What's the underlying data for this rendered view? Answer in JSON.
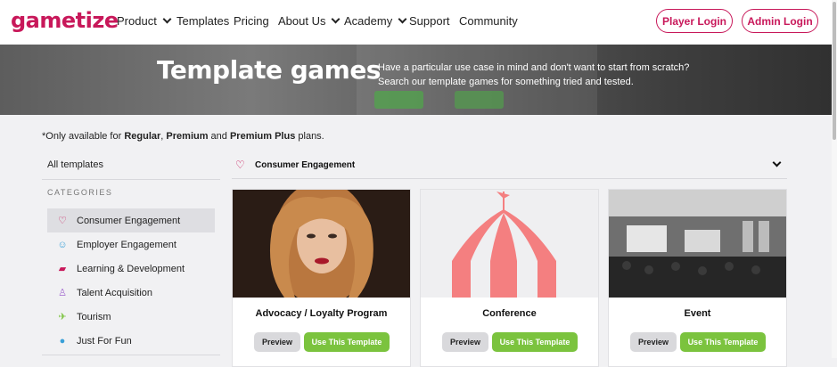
{
  "brand": {
    "logo_text": "gametize",
    "color": "#c8185a"
  },
  "nav": {
    "items": [
      {
        "label": "Product",
        "has_dropdown": true
      },
      {
        "label": "Templates",
        "has_dropdown": false
      },
      {
        "label": "Pricing",
        "has_dropdown": false
      },
      {
        "label": "About Us",
        "has_dropdown": true
      },
      {
        "label": "Academy",
        "has_dropdown": true
      },
      {
        "label": "Support",
        "has_dropdown": false
      },
      {
        "label": "Community",
        "has_dropdown": false
      }
    ],
    "player_login": "Player Login",
    "admin_login": "Admin Login"
  },
  "hero": {
    "title": "Template games",
    "subtitle_line1": "Have a particular use case in mind and don't want to start from scratch?",
    "subtitle_line2": "Search our template games for something tried and tested."
  },
  "note": {
    "prefix": "*Only available for ",
    "plan1": "Regular",
    "sep1": ", ",
    "plan2": "Premium",
    "sep2": " and ",
    "plan3": "Premium Plus",
    "suffix": " plans."
  },
  "sidebar": {
    "all_templates": "All templates",
    "categories_heading": "CATEGORIES",
    "categories": [
      {
        "label": "Consumer Engagement",
        "icon": "heart-icon",
        "color": "#c8185a",
        "active": true
      },
      {
        "label": "Employer Engagement",
        "icon": "smiley-icon",
        "color": "#3aa0d8",
        "active": false
      },
      {
        "label": "Learning & Development",
        "icon": "book-icon",
        "color": "#c8185a",
        "active": false
      },
      {
        "label": "Talent Acquisition",
        "icon": "user-icon",
        "color": "#a36bd0",
        "active": false
      },
      {
        "label": "Tourism",
        "icon": "plane-icon",
        "color": "#7bc33e",
        "active": false
      },
      {
        "label": "Just For Fun",
        "icon": "soccer-ball-icon",
        "color": "#3aa0d8",
        "active": false
      }
    ]
  },
  "filter": {
    "selected": "Consumer Engagement",
    "icon": "heart-icon"
  },
  "cards": [
    {
      "title": "Advocacy / Loyalty Program",
      "preview": "Preview",
      "use": "Use This Template"
    },
    {
      "title": "Conference",
      "preview": "Preview",
      "use": "Use This Template"
    },
    {
      "title": "Event",
      "preview": "Preview",
      "use": "Use This Template"
    }
  ],
  "colors": {
    "accent": "#c8185a",
    "green": "#7bc33e",
    "tent": "#f47f80"
  }
}
